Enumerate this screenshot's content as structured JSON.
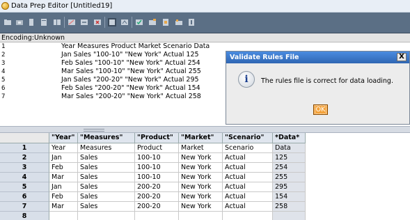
{
  "window": {
    "title": "Data Prep Editor [Untitled19]"
  },
  "toolbar": {
    "buttons": [
      "open-icon",
      "open-rules-icon",
      "data-source-icon",
      "field-properties-icon",
      "join-icon",
      "split-icon",
      "move-icon",
      "delete-icon",
      "dimension-build-icon",
      "data-load-icon",
      "validate-icon",
      "associate-outline-icon",
      "data-file-properties-icon",
      "rules-icon",
      "help-icon"
    ]
  },
  "encoding": {
    "label": "Encoding:Unknown"
  },
  "data_file": {
    "lines": [
      {
        "num": "1",
        "text": "Year Measures Product Market Scenario Data"
      },
      {
        "num": "2",
        "text": "Jan Sales \"100-10\" \"New York\" Actual 125"
      },
      {
        "num": "3",
        "text": "Feb Sales \"100-10\" \"New York\" Actual 254"
      },
      {
        "num": "4",
        "text": "Mar Sales \"100-10\" \"New York\" Actual 255"
      },
      {
        "num": "5",
        "text": "Jan Sales \"200-20\" \"New York\" Actual 295"
      },
      {
        "num": "6",
        "text": "Feb Sales \"200-20\" \"New York\" Actual 154"
      },
      {
        "num": "7",
        "text": "Mar Sales \"200-20\" \"New York\" Actual 258"
      }
    ]
  },
  "grid": {
    "columns": [
      "\"Year\"",
      "\"Measures\"",
      "\"Product\"",
      "\"Market\"",
      "\"Scenario\"",
      "*Data*"
    ],
    "rows": [
      {
        "num": "1",
        "cells": [
          "Year",
          "Measures",
          "Product",
          "Market",
          "Scenario",
          "Data"
        ]
      },
      {
        "num": "2",
        "cells": [
          "Jan",
          "Sales",
          "100-10",
          "New York",
          "Actual",
          "125"
        ]
      },
      {
        "num": "3",
        "cells": [
          "Feb",
          "Sales",
          "100-10",
          "New York",
          "Actual",
          "254"
        ]
      },
      {
        "num": "4",
        "cells": [
          "Mar",
          "Sales",
          "100-10",
          "New York",
          "Actual",
          "255"
        ]
      },
      {
        "num": "5",
        "cells": [
          "Jan",
          "Sales",
          "200-20",
          "New York",
          "Actual",
          "295"
        ]
      },
      {
        "num": "6",
        "cells": [
          "Feb",
          "Sales",
          "200-20",
          "New York",
          "Actual",
          "154"
        ]
      },
      {
        "num": "7",
        "cells": [
          "Mar",
          "Sales",
          "200-20",
          "New York",
          "Actual",
          "258"
        ]
      },
      {
        "num": "8",
        "cells": [
          "",
          "",
          "",
          "",
          "",
          ""
        ]
      }
    ]
  },
  "dialog": {
    "title": "Validate Rules File",
    "close_label": "X",
    "message": "The rules file is correct for data loading.",
    "ok_label": "OK",
    "icon": "info-icon"
  },
  "colors": {
    "dialog_title": "#2f66b3",
    "ok_button": "#f4a33c",
    "toolbar": "#5b6f85"
  }
}
